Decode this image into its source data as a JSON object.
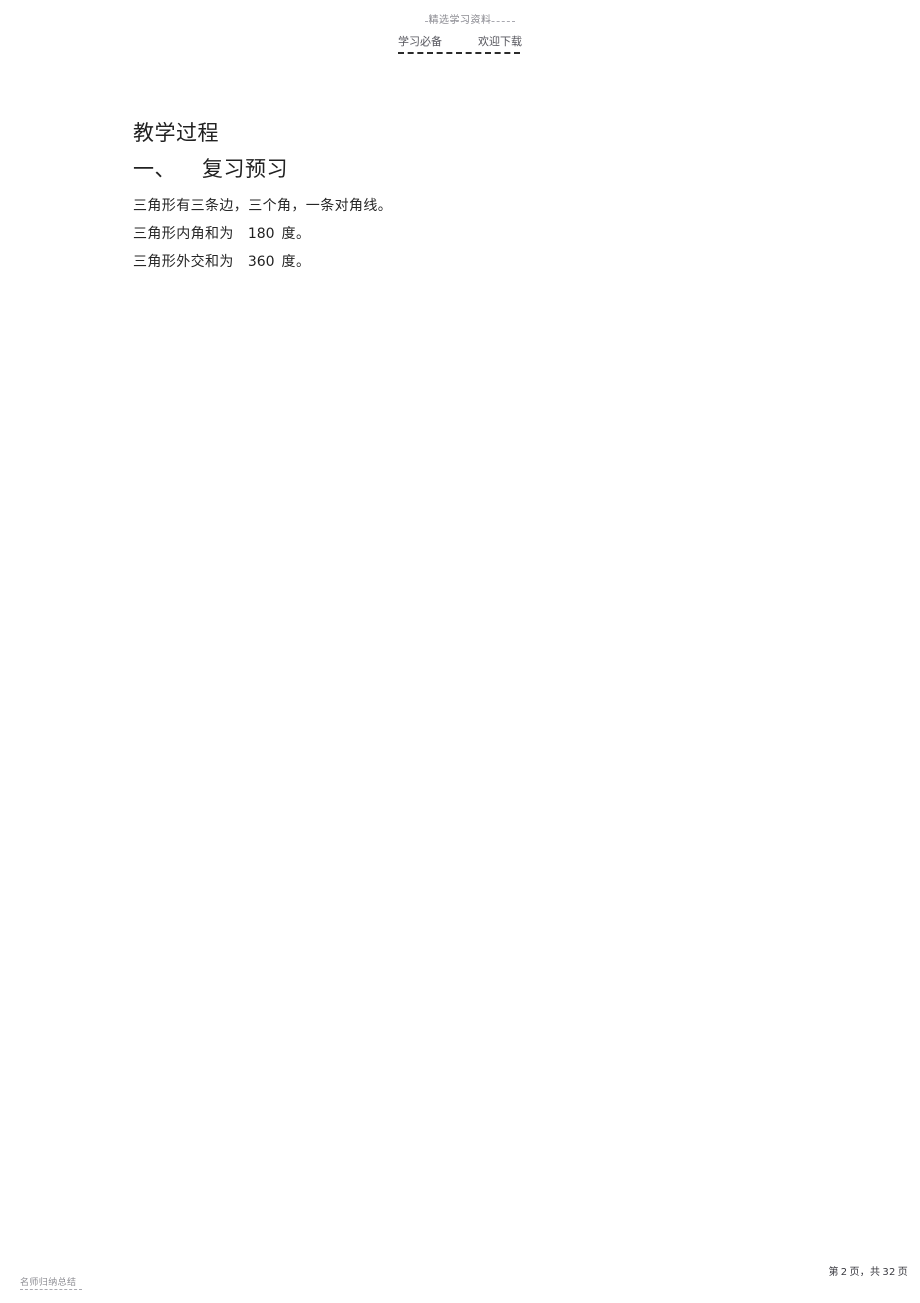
{
  "document": {
    "watermark_top": "精选学习资料",
    "watermark_bottom": "名师归纳总结",
    "header_left": "学习必备",
    "header_right": "欢迎下载"
  },
  "content": {
    "title": "教学过程",
    "section": {
      "number": "一、",
      "label": "复习预习"
    },
    "paragraphs": [
      {
        "text": "三角形有三条边，三个角，一条对角线。"
      }
    ],
    "statements": [
      {
        "lead": "三角形内角和为",
        "value": "180",
        "tail": "度。"
      },
      {
        "lead": "三角形外交和为",
        "value": "360",
        "tail": "度。"
      }
    ]
  },
  "footer": {
    "page_prefix": "第",
    "page_current": "2",
    "page_mid": "页，共",
    "page_total": "32",
    "page_suffix": "页"
  },
  "colors": {
    "text": "#262626",
    "watermark": "#8d8d93",
    "rule": "#2b2b2b"
  }
}
